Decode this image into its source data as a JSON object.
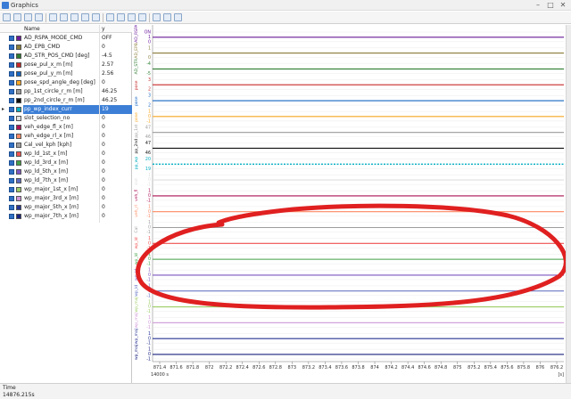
{
  "window": {
    "title": "Graphics",
    "min_label": "–",
    "max_label": "□",
    "close_label": "✕"
  },
  "toolbar": {
    "icons": [
      "table-icon",
      "cursor-icon",
      "chart-icon",
      "zoom-in-icon",
      "zoom-out-icon",
      "zoom-fit-icon",
      "measure-icon",
      "filter-icon",
      "nav-left-icon",
      "nav-right-icon",
      "window-icon",
      "undo-icon",
      "redo-icon",
      "settings-icon",
      "export-icon",
      "help-icon"
    ]
  },
  "list": {
    "header_name": "Name",
    "header_y": "y",
    "signals": [
      {
        "name": "AD_RSPA_MODE_CMD",
        "value": "OFF",
        "color": "#6a1b9a"
      },
      {
        "name": "AD_EPB_CMD",
        "value": "0",
        "color": "#8b7d3a"
      },
      {
        "name": "AD_STR_POS_CMD [deg]",
        "value": "-4.5",
        "color": "#2e7d32"
      },
      {
        "name": "pose_pul_x_m [m]",
        "value": "2.57",
        "color": "#c62828"
      },
      {
        "name": "pose_pul_y_m [m]",
        "value": "2.56",
        "color": "#1565c0"
      },
      {
        "name": "pose_spd_angle_deg [deg]",
        "value": "0",
        "color": "#f9a825"
      },
      {
        "name": "pp_1st_circle_r_m [m]",
        "value": "46.25",
        "color": "#999999"
      },
      {
        "name": "pp_2nd_circle_r_m [m]",
        "value": "46.25",
        "color": "#111111"
      },
      {
        "name": "pp_wp_index_curr",
        "value": "19",
        "color": "#00acc1",
        "selected": true
      },
      {
        "name": "slot_selection_no",
        "value": "0",
        "color": "#e0e0e0"
      },
      {
        "name": "veh_edge_fl_x [m]",
        "value": "0",
        "color": "#ad1457"
      },
      {
        "name": "veh_edge_rl_x [m]",
        "value": "0",
        "color": "#ff8a65"
      },
      {
        "name": "Cal_vel_kph [kph]",
        "value": "0",
        "color": "#9e9e9e"
      },
      {
        "name": "wp_ld_1st_x [m]",
        "value": "0",
        "color": "#ef5350"
      },
      {
        "name": "wp_ld_3rd_x [m]",
        "value": "0",
        "color": "#43a047"
      },
      {
        "name": "wp_ld_5th_x [m]",
        "value": "0",
        "color": "#7e57c2"
      },
      {
        "name": "wp_ld_7th_x [m]",
        "value": "0",
        "color": "#5c6bc0"
      },
      {
        "name": "wp_major_1st_x [m]",
        "value": "0",
        "color": "#9ccc65"
      },
      {
        "name": "wp_major_3rd_x [m]",
        "value": "0",
        "color": "#ce93d8"
      },
      {
        "name": "wp_major_5th_x [m]",
        "value": "0",
        "color": "#283593"
      },
      {
        "name": "wp_major_7th_x [m]",
        "value": "0",
        "color": "#1a237e"
      }
    ]
  },
  "status": {
    "time_label": "Time",
    "time_value": "14876.215s"
  },
  "chart_data": {
    "type": "line",
    "x_ticks": [
      "871.4",
      "871.6",
      "871.8",
      "872",
      "872.2",
      "872.4",
      "872.6",
      "872.8",
      "873",
      "873.2",
      "873.4",
      "873.6",
      "873.8",
      "874",
      "874.2",
      "874.4",
      "874.6",
      "874.8",
      "875",
      "875.2",
      "875.4",
      "875.6",
      "875.8",
      "876",
      "876.2"
    ],
    "x_prefix": "14000 s",
    "x_unit": "[s]",
    "lanes": [
      {
        "label": "AD_RSPA",
        "ticks": [
          "ON",
          "1",
          "0"
        ],
        "color": "#6a1b9a"
      },
      {
        "label": "AD_EPB",
        "ticks": [
          "1",
          "0"
        ],
        "color": "#8b7d3a"
      },
      {
        "label": "AD_STR",
        "ticks": [
          "-4",
          "-5"
        ],
        "color": "#2e7d32"
      },
      {
        "label": "pose",
        "ticks": [
          "3",
          "2"
        ],
        "color": "#c62828"
      },
      {
        "label": "pose",
        "ticks": [
          "3",
          "2"
        ],
        "color": "#1565c0"
      },
      {
        "label": "pose",
        "ticks": [
          "1",
          "0",
          "-1"
        ],
        "color": "#f9a825"
      },
      {
        "label": "pp_1st",
        "ticks": [
          "47",
          "46"
        ],
        "color": "#999999"
      },
      {
        "label": "pp_2nd",
        "ticks": [
          "47",
          "46"
        ],
        "color": "#111111"
      },
      {
        "label": "pp_wp",
        "ticks": [
          "20",
          "19"
        ],
        "color": "#00acc1"
      },
      {
        "label": "slot",
        "ticks": [
          "1",
          "0",
          "-1"
        ],
        "color": "#e0e0e0"
      },
      {
        "label": "veh_fl",
        "ticks": [
          "1",
          "0",
          "-1"
        ],
        "color": "#ad1457"
      },
      {
        "label": "veh_rl",
        "ticks": [
          "1",
          "0",
          "-1"
        ],
        "color": "#ff8a65"
      },
      {
        "label": "Cal",
        "ticks": [
          "1",
          "0",
          "-1"
        ],
        "color": "#9e9e9e"
      },
      {
        "label": "wp_ld",
        "ticks": [
          "1",
          "0",
          "-1"
        ],
        "color": "#ef5350"
      },
      {
        "label": "wp_ld",
        "ticks": [
          "1",
          "0",
          "-1"
        ],
        "color": "#43a047"
      },
      {
        "label": "wp_ld",
        "ticks": [
          "1",
          "0",
          "-1"
        ],
        "color": "#7e57c2"
      },
      {
        "label": "wp_ld",
        "ticks": [
          "1",
          "0",
          "-1"
        ],
        "color": "#5c6bc0"
      },
      {
        "label": "wp_maj",
        "ticks": [
          "1",
          "0",
          "-1"
        ],
        "color": "#9ccc65"
      },
      {
        "label": "wp_maj",
        "ticks": [
          "1",
          "0",
          "-1"
        ],
        "color": "#ce93d8"
      },
      {
        "label": "wp_maj",
        "ticks": [
          "1",
          "0",
          "-1"
        ],
        "color": "#283593"
      },
      {
        "label": "wp_maj",
        "ticks": [
          "1",
          "0",
          "-1"
        ],
        "color": "#1a237e"
      }
    ],
    "annotation": {
      "shape": "ellipse",
      "color": "#e02020"
    }
  }
}
